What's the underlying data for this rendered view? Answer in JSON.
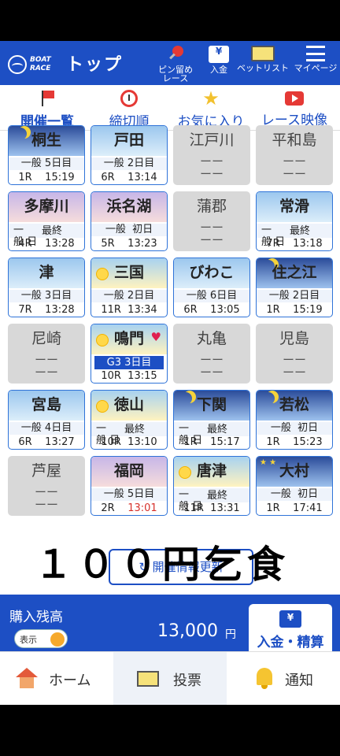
{
  "header": {
    "logo_line1": "BOAT",
    "logo_line2": "RACE",
    "title": "トップ",
    "buttons": [
      {
        "label": "ピン留め\nレース",
        "icon": "pin-icon"
      },
      {
        "label": "入金",
        "icon": "atm-icon"
      },
      {
        "label": "ベットリスト",
        "icon": "ticket-icon"
      },
      {
        "label": "マイページ",
        "icon": "menu-icon"
      }
    ]
  },
  "tabs": [
    {
      "label": "開催一覧",
      "icon": "flag-icon",
      "active": true
    },
    {
      "label": "締切順",
      "icon": "alarm-clock-icon"
    },
    {
      "label": "お気に入り",
      "icon": "star-icon"
    },
    {
      "label": "レース映像",
      "icon": "video-play-icon"
    }
  ],
  "venues": [
    {
      "name": "桐生",
      "status": "open",
      "theme": "night",
      "line1": "一般 5日目",
      "line2": "1R    15:19"
    },
    {
      "name": "戸田",
      "status": "open",
      "theme": "day",
      "line1": "一般 2日目",
      "line2": "6R    13:14"
    },
    {
      "name": "江戸川",
      "status": "closed",
      "dash": "ーー"
    },
    {
      "name": "平和島",
      "status": "closed",
      "dash": "ーー"
    },
    {
      "name": "多摩川",
      "status": "open",
      "theme": "eve",
      "wrap_top": "一",
      "wrap_final": "最終",
      "wrap_han": "般  日",
      "line2": "4R    13:28"
    },
    {
      "name": "浜名湖",
      "status": "open",
      "theme": "eve",
      "line1": "一般  初日",
      "line2": "5R    13:23"
    },
    {
      "name": "蒲郡",
      "status": "closed",
      "dash": "ーー"
    },
    {
      "name": "常滑",
      "status": "open",
      "theme": "day",
      "wrap_top": "一",
      "wrap_final": "最終",
      "wrap_han": "般  日",
      "line2": "7R    13:18"
    },
    {
      "name": "津",
      "status": "open",
      "theme": "day",
      "line1": "一般 3日目",
      "line2": "7R    13:28"
    },
    {
      "name": "三国",
      "status": "open",
      "theme": "sun",
      "line1": "一般 2日目",
      "line2": "11R  13:34"
    },
    {
      "name": "びわこ",
      "status": "open",
      "theme": "day",
      "line1": "一般 6日目",
      "line2": "6R    13:05"
    },
    {
      "name": "住之江",
      "status": "open",
      "theme": "night",
      "line1": "一般 2日目",
      "line2": "1R    15:19"
    },
    {
      "name": "尼崎",
      "status": "closed",
      "dash": "ーー"
    },
    {
      "name": "鳴門",
      "status": "open",
      "theme": "sun",
      "grade": "G3  3日目",
      "favorite": true,
      "line2": "10R  13:15"
    },
    {
      "name": "丸亀",
      "status": "closed",
      "dash": "ーー"
    },
    {
      "name": "児島",
      "status": "closed",
      "dash": "ーー"
    },
    {
      "name": "宮島",
      "status": "open",
      "theme": "day",
      "line1": "一般 4日目",
      "line2": "6R    13:27"
    },
    {
      "name": "徳山",
      "status": "open",
      "theme": "sun",
      "wrap_top": "一",
      "wrap_final": "最終",
      "wrap_han": "般  日",
      "line2": "10R  13:10"
    },
    {
      "name": "下関",
      "status": "open",
      "theme": "night",
      "wrap_top": "一",
      "wrap_final": "最終",
      "wrap_han": "般  日",
      "line2": "1R    15:17"
    },
    {
      "name": "若松",
      "status": "open",
      "theme": "night",
      "line1": "一般  初日",
      "line2": "1R    15:23"
    },
    {
      "name": "芦屋",
      "status": "closed",
      "dash": "ーー"
    },
    {
      "name": "福岡",
      "status": "open",
      "theme": "eve",
      "line1": "一般 5日目",
      "line2_r": "2R",
      "line2_t": "13:01",
      "time_red": true
    },
    {
      "name": "唐津",
      "status": "open",
      "theme": "sun",
      "wrap_top": "一",
      "wrap_final": "最終",
      "wrap_han": "般  日",
      "line2": "11R  13:31"
    },
    {
      "name": "大村",
      "status": "open",
      "theme": "night-stars",
      "line1": "一般  初日",
      "line2": "1R    17:41"
    }
  ],
  "refresh_label": "開催情報更新",
  "overlay_text": "１００円乞食",
  "balance": {
    "label": "購入残高",
    "toggle_label": "表示",
    "amount": "13,000",
    "unit": "円",
    "deposit_label": "入金・精算"
  },
  "bottom_nav": [
    {
      "label": "ホーム",
      "icon": "home-icon"
    },
    {
      "label": "投票",
      "icon": "ticket-icon"
    },
    {
      "label": "通知",
      "icon": "bell-icon"
    }
  ],
  "colors": {
    "brand": "#1d4fc4",
    "accent_red": "#d6302a",
    "favorite": "#e0204f"
  }
}
